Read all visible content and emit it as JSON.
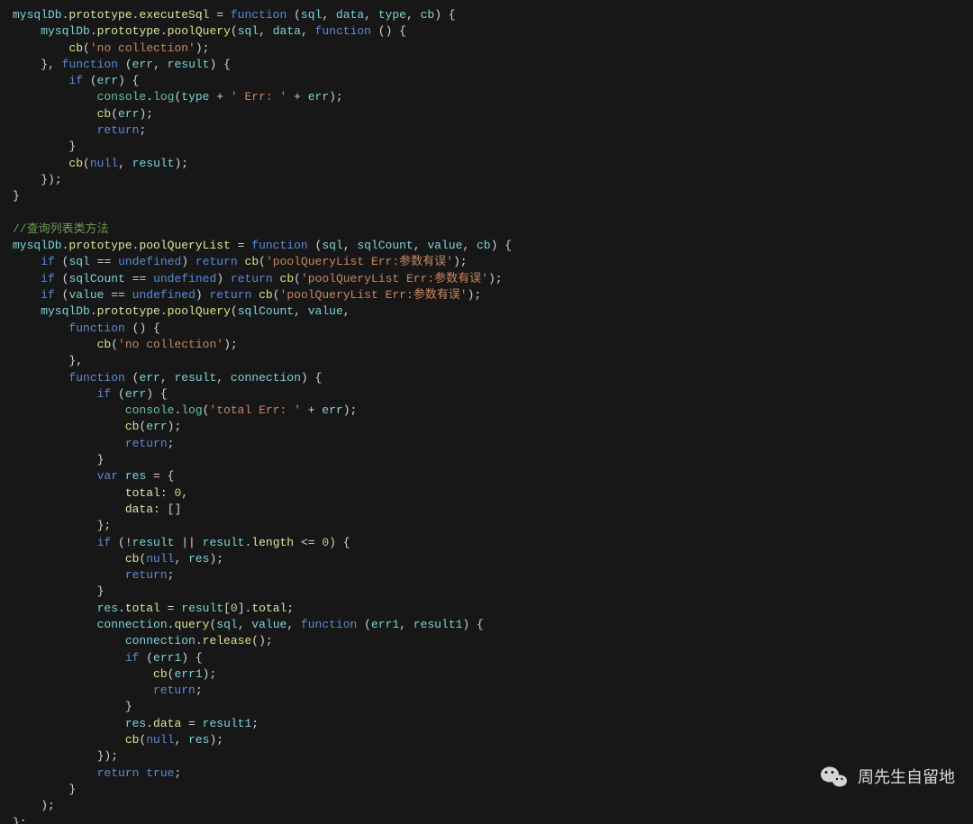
{
  "watermark": {
    "label": "周先生自留地"
  },
  "code": {
    "lines": [
      [
        [
          "id",
          "mysqlDb"
        ],
        [
          "op",
          "."
        ],
        [
          "prop",
          "prototype"
        ],
        [
          "op",
          "."
        ],
        [
          "prop",
          "executeSql"
        ],
        [
          "op",
          " = "
        ],
        [
          "key",
          "function"
        ],
        [
          "op",
          " ("
        ],
        [
          "id",
          "sql"
        ],
        [
          "op",
          ", "
        ],
        [
          "id",
          "data"
        ],
        [
          "op",
          ", "
        ],
        [
          "id",
          "type"
        ],
        [
          "op",
          ", "
        ],
        [
          "id",
          "cb"
        ],
        [
          "op",
          ") {"
        ]
      ],
      [
        [
          "in",
          1
        ],
        [
          "id",
          "mysqlDb"
        ],
        [
          "op",
          "."
        ],
        [
          "prop",
          "prototype"
        ],
        [
          "op",
          "."
        ],
        [
          "func",
          "poolQuery"
        ],
        [
          "op",
          "("
        ],
        [
          "id",
          "sql"
        ],
        [
          "op",
          ", "
        ],
        [
          "id",
          "data"
        ],
        [
          "op",
          ", "
        ],
        [
          "key",
          "function"
        ],
        [
          "op",
          " () {"
        ]
      ],
      [
        [
          "in",
          2
        ],
        [
          "func",
          "cb"
        ],
        [
          "op",
          "("
        ],
        [
          "str",
          "'no collection'"
        ],
        [
          "op",
          ");"
        ]
      ],
      [
        [
          "in",
          1
        ],
        [
          "op",
          "}, "
        ],
        [
          "key",
          "function"
        ],
        [
          "op",
          " ("
        ],
        [
          "id",
          "err"
        ],
        [
          "op",
          ", "
        ],
        [
          "id",
          "result"
        ],
        [
          "op",
          ") {"
        ]
      ],
      [
        [
          "in",
          2
        ],
        [
          "key",
          "if"
        ],
        [
          "op",
          " ("
        ],
        [
          "id",
          "err"
        ],
        [
          "op",
          ") {"
        ]
      ],
      [
        [
          "in",
          3
        ],
        [
          "log",
          "console"
        ],
        [
          "op",
          "."
        ],
        [
          "log",
          "log"
        ],
        [
          "op",
          "("
        ],
        [
          "id",
          "type"
        ],
        [
          "op",
          " + "
        ],
        [
          "str",
          "' Err: '"
        ],
        [
          "op",
          " + "
        ],
        [
          "id",
          "err"
        ],
        [
          "op",
          ");"
        ]
      ],
      [
        [
          "in",
          3
        ],
        [
          "func",
          "cb"
        ],
        [
          "op",
          "("
        ],
        [
          "id",
          "err"
        ],
        [
          "op",
          ");"
        ]
      ],
      [
        [
          "in",
          3
        ],
        [
          "key",
          "return"
        ],
        [
          "op",
          ";"
        ]
      ],
      [
        [
          "in",
          2
        ],
        [
          "op",
          "}"
        ]
      ],
      [
        [
          "in",
          2
        ],
        [
          "func",
          "cb"
        ],
        [
          "op",
          "("
        ],
        [
          "const",
          "null"
        ],
        [
          "op",
          ", "
        ],
        [
          "id",
          "result"
        ],
        [
          "op",
          ");"
        ]
      ],
      [
        [
          "in",
          1
        ],
        [
          "op",
          "});"
        ]
      ],
      [
        [
          "op",
          "}"
        ]
      ],
      [
        [
          "blank",
          ""
        ]
      ],
      [
        [
          "cmt",
          "//查询列表类方法"
        ]
      ],
      [
        [
          "id",
          "mysqlDb"
        ],
        [
          "op",
          "."
        ],
        [
          "prop",
          "prototype"
        ],
        [
          "op",
          "."
        ],
        [
          "prop",
          "poolQueryList"
        ],
        [
          "op",
          " = "
        ],
        [
          "key",
          "function"
        ],
        [
          "op",
          " ("
        ],
        [
          "id",
          "sql"
        ],
        [
          "op",
          ", "
        ],
        [
          "id",
          "sqlCount"
        ],
        [
          "op",
          ", "
        ],
        [
          "id",
          "value"
        ],
        [
          "op",
          ", "
        ],
        [
          "id",
          "cb"
        ],
        [
          "op",
          ") {"
        ]
      ],
      [
        [
          "in",
          1
        ],
        [
          "key",
          "if"
        ],
        [
          "op",
          " ("
        ],
        [
          "id",
          "sql"
        ],
        [
          "op",
          " == "
        ],
        [
          "const",
          "undefined"
        ],
        [
          "op",
          ") "
        ],
        [
          "key",
          "return"
        ],
        [
          "op",
          " "
        ],
        [
          "func",
          "cb"
        ],
        [
          "op",
          "("
        ],
        [
          "str",
          "'poolQueryList Err:参数有误'"
        ],
        [
          "op",
          ");"
        ]
      ],
      [
        [
          "in",
          1
        ],
        [
          "key",
          "if"
        ],
        [
          "op",
          " ("
        ],
        [
          "id",
          "sqlCount"
        ],
        [
          "op",
          " == "
        ],
        [
          "const",
          "undefined"
        ],
        [
          "op",
          ") "
        ],
        [
          "key",
          "return"
        ],
        [
          "op",
          " "
        ],
        [
          "func",
          "cb"
        ],
        [
          "op",
          "("
        ],
        [
          "str",
          "'poolQueryList Err:参数有误'"
        ],
        [
          "op",
          ");"
        ]
      ],
      [
        [
          "in",
          1
        ],
        [
          "key",
          "if"
        ],
        [
          "op",
          " ("
        ],
        [
          "id",
          "value"
        ],
        [
          "op",
          " == "
        ],
        [
          "const",
          "undefined"
        ],
        [
          "op",
          ") "
        ],
        [
          "key",
          "return"
        ],
        [
          "op",
          " "
        ],
        [
          "func",
          "cb"
        ],
        [
          "op",
          "("
        ],
        [
          "str",
          "'poolQueryList Err:参数有误'"
        ],
        [
          "op",
          ");"
        ]
      ],
      [
        [
          "in",
          1
        ],
        [
          "id",
          "mysqlDb"
        ],
        [
          "op",
          "."
        ],
        [
          "prop",
          "prototype"
        ],
        [
          "op",
          "."
        ],
        [
          "func",
          "poolQuery"
        ],
        [
          "op",
          "("
        ],
        [
          "id",
          "sqlCount"
        ],
        [
          "op",
          ", "
        ],
        [
          "id",
          "value"
        ],
        [
          "op",
          ","
        ]
      ],
      [
        [
          "in",
          2
        ],
        [
          "key",
          "function"
        ],
        [
          "op",
          " () {"
        ]
      ],
      [
        [
          "in",
          3
        ],
        [
          "func",
          "cb"
        ],
        [
          "op",
          "("
        ],
        [
          "str",
          "'no collection'"
        ],
        [
          "op",
          ");"
        ]
      ],
      [
        [
          "in",
          2
        ],
        [
          "op",
          "},"
        ]
      ],
      [
        [
          "in",
          2
        ],
        [
          "key",
          "function"
        ],
        [
          "op",
          " ("
        ],
        [
          "id",
          "err"
        ],
        [
          "op",
          ", "
        ],
        [
          "id",
          "result"
        ],
        [
          "op",
          ", "
        ],
        [
          "id",
          "connection"
        ],
        [
          "op",
          ") {"
        ]
      ],
      [
        [
          "in",
          3
        ],
        [
          "key",
          "if"
        ],
        [
          "op",
          " ("
        ],
        [
          "id",
          "err"
        ],
        [
          "op",
          ") {"
        ]
      ],
      [
        [
          "in",
          4
        ],
        [
          "log",
          "console"
        ],
        [
          "op",
          "."
        ],
        [
          "log",
          "log"
        ],
        [
          "op",
          "("
        ],
        [
          "str",
          "'total Err: '"
        ],
        [
          "op",
          " + "
        ],
        [
          "id",
          "err"
        ],
        [
          "op",
          ");"
        ]
      ],
      [
        [
          "in",
          4
        ],
        [
          "func",
          "cb"
        ],
        [
          "op",
          "("
        ],
        [
          "id",
          "err"
        ],
        [
          "op",
          ");"
        ]
      ],
      [
        [
          "in",
          4
        ],
        [
          "key",
          "return"
        ],
        [
          "op",
          ";"
        ]
      ],
      [
        [
          "in",
          3
        ],
        [
          "op",
          "}"
        ]
      ],
      [
        [
          "in",
          3
        ],
        [
          "key",
          "var"
        ],
        [
          "op",
          " "
        ],
        [
          "id",
          "res"
        ],
        [
          "op",
          " = {"
        ]
      ],
      [
        [
          "in",
          4
        ],
        [
          "prop",
          "total"
        ],
        [
          "op",
          ": "
        ],
        [
          "num",
          "0"
        ],
        [
          "op",
          ","
        ]
      ],
      [
        [
          "in",
          4
        ],
        [
          "prop",
          "data"
        ],
        [
          "op",
          ": []"
        ]
      ],
      [
        [
          "in",
          3
        ],
        [
          "op",
          "};"
        ]
      ],
      [
        [
          "in",
          3
        ],
        [
          "key",
          "if"
        ],
        [
          "op",
          " (!"
        ],
        [
          "id",
          "result"
        ],
        [
          "op",
          " || "
        ],
        [
          "id",
          "result"
        ],
        [
          "op",
          "."
        ],
        [
          "prop",
          "length"
        ],
        [
          "op",
          " <= "
        ],
        [
          "num",
          "0"
        ],
        [
          "op",
          ") {"
        ]
      ],
      [
        [
          "in",
          4
        ],
        [
          "func",
          "cb"
        ],
        [
          "op",
          "("
        ],
        [
          "const",
          "null"
        ],
        [
          "op",
          ", "
        ],
        [
          "id",
          "res"
        ],
        [
          "op",
          ");"
        ]
      ],
      [
        [
          "in",
          4
        ],
        [
          "key",
          "return"
        ],
        [
          "op",
          ";"
        ]
      ],
      [
        [
          "in",
          3
        ],
        [
          "op",
          "}"
        ]
      ],
      [
        [
          "in",
          3
        ],
        [
          "id",
          "res"
        ],
        [
          "op",
          "."
        ],
        [
          "prop",
          "total"
        ],
        [
          "op",
          " = "
        ],
        [
          "id",
          "result"
        ],
        [
          "op",
          "["
        ],
        [
          "num",
          "0"
        ],
        [
          "op",
          "]."
        ],
        [
          "prop",
          "total"
        ],
        [
          "op",
          ";"
        ]
      ],
      [
        [
          "in",
          3
        ],
        [
          "id",
          "connection"
        ],
        [
          "op",
          "."
        ],
        [
          "func",
          "query"
        ],
        [
          "op",
          "("
        ],
        [
          "id",
          "sql"
        ],
        [
          "op",
          ", "
        ],
        [
          "id",
          "value"
        ],
        [
          "op",
          ", "
        ],
        [
          "key",
          "function"
        ],
        [
          "op",
          " ("
        ],
        [
          "id",
          "err1"
        ],
        [
          "op",
          ", "
        ],
        [
          "id",
          "result1"
        ],
        [
          "op",
          ") {"
        ]
      ],
      [
        [
          "in",
          4
        ],
        [
          "id",
          "connection"
        ],
        [
          "op",
          "."
        ],
        [
          "func",
          "release"
        ],
        [
          "op",
          "();"
        ]
      ],
      [
        [
          "in",
          4
        ],
        [
          "key",
          "if"
        ],
        [
          "op",
          " ("
        ],
        [
          "id",
          "err1"
        ],
        [
          "op",
          ") {"
        ]
      ],
      [
        [
          "in",
          5
        ],
        [
          "func",
          "cb"
        ],
        [
          "op",
          "("
        ],
        [
          "id",
          "err1"
        ],
        [
          "op",
          ");"
        ]
      ],
      [
        [
          "in",
          5
        ],
        [
          "key",
          "return"
        ],
        [
          "op",
          ";"
        ]
      ],
      [
        [
          "in",
          4
        ],
        [
          "op",
          "}"
        ]
      ],
      [
        [
          "in",
          4
        ],
        [
          "id",
          "res"
        ],
        [
          "op",
          "."
        ],
        [
          "prop",
          "data"
        ],
        [
          "op",
          " = "
        ],
        [
          "id",
          "result1"
        ],
        [
          "op",
          ";"
        ]
      ],
      [
        [
          "in",
          4
        ],
        [
          "func",
          "cb"
        ],
        [
          "op",
          "("
        ],
        [
          "const",
          "null"
        ],
        [
          "op",
          ", "
        ],
        [
          "id",
          "res"
        ],
        [
          "op",
          ");"
        ]
      ],
      [
        [
          "in",
          3
        ],
        [
          "op",
          "});"
        ]
      ],
      [
        [
          "in",
          3
        ],
        [
          "key",
          "return"
        ],
        [
          "op",
          " "
        ],
        [
          "const",
          "true"
        ],
        [
          "op",
          ";"
        ]
      ],
      [
        [
          "in",
          2
        ],
        [
          "op",
          "}"
        ]
      ],
      [
        [
          "in",
          1
        ],
        [
          "op",
          ");"
        ]
      ],
      [
        [
          "op",
          "};"
        ]
      ]
    ]
  }
}
